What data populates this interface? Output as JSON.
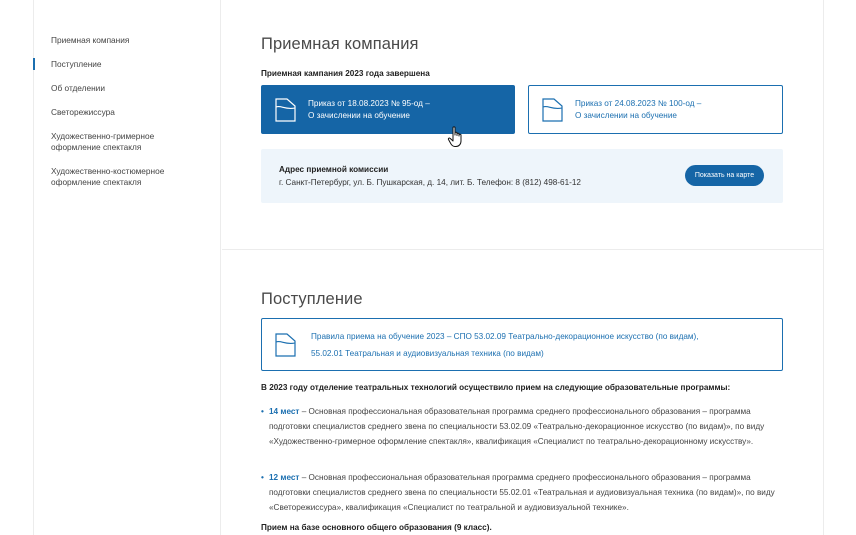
{
  "sidebar": {
    "items": [
      {
        "label": "Приемная компания"
      },
      {
        "label": "Поступление"
      },
      {
        "label": "Об отделении"
      },
      {
        "label": "Светорежиссура"
      },
      {
        "label": "Художественно-гримерное оформление спектакля"
      },
      {
        "label": "Художественно-костюмерное оформление спектакля"
      }
    ],
    "active_item": "Поступление"
  },
  "admission": {
    "title": "Приемная компания",
    "status": "Приемная кампания 2023 года завершена",
    "docs": [
      {
        "line1": "Приказ от 18.08.2023 № 95-од –",
        "line2": "О зачислении на обучение"
      },
      {
        "line1": "Приказ от 24.08.2023 № 100-од –",
        "line2": "О зачислении на обучение"
      }
    ],
    "address": {
      "title": "Адрес приемной комиссии",
      "text": "г. Санкт-Петербург, ул. Б. Пушкарская, д. 14, лит. Б. Телефон: 8 (812) 498-61-12",
      "map_button": "Показать на карте"
    }
  },
  "enrollment": {
    "title": "Поступление",
    "rules": {
      "line1": "Правила приема на обучение 2023 – СПО 53.02.09 Театрально-декорационное искусство (по видам),",
      "line2": "55.02.01 Театральная и аудиовизуальная техника (по видам)"
    },
    "intro": "В 2023 году отделение театральных технологий осуществило прием на следующие образовательные программы:",
    "programs": [
      {
        "count": "14 мест",
        "text": " – Основная профессиональная образовательная программа среднего профессионального образования – программа подготовки специалистов среднего звена по специальности 53.02.09 «Театрально-декорационное искусство (по видам)», по виду «Художественно-гримерное оформление спектакля», квалификация «Специалист по театрально-декорационному искусству»."
      },
      {
        "count": "12 мест",
        "text": " – Основная профессиональная образовательная программа среднего профессионального образования – программа подготовки специалистов среднего звена по специальности 55.02.01 «Театральная и аудиовизуальная техника (по видам)», по виду «Светорежиссура», квалификация «Специалист по театральной и аудиовизуальной технике»."
      }
    ],
    "footer": "Прием на базе основного общего образования (9 класс)."
  },
  "colors": {
    "accent": "#1565a6",
    "accent_text": "#1b6fb0",
    "address_bg": "#eef5fb"
  },
  "icons": {
    "document": "document-icon",
    "cursor": "hand-pointer-icon"
  }
}
